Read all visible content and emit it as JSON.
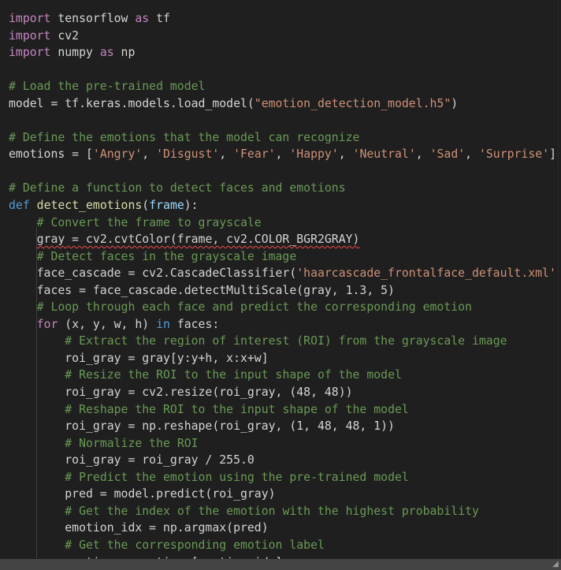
{
  "editor": {
    "language": "python",
    "lines": [
      [
        [
          "kw2",
          "import"
        ],
        [
          "p",
          " tensorflow "
        ],
        [
          "kw2",
          "as"
        ],
        [
          "p",
          " tf"
        ]
      ],
      [
        [
          "kw2",
          "import"
        ],
        [
          "p",
          " cv2"
        ]
      ],
      [
        [
          "kw2",
          "import"
        ],
        [
          "p",
          " numpy "
        ],
        [
          "kw2",
          "as"
        ],
        [
          "p",
          " np"
        ]
      ],
      [],
      [
        [
          "cm",
          "# Load the pre-trained model"
        ]
      ],
      [
        [
          "p",
          "model = tf.keras.models.load_model("
        ],
        [
          "st",
          "\"emotion_detection_model.h5\""
        ],
        [
          "p",
          ")"
        ]
      ],
      [],
      [
        [
          "cm",
          "# Define the emotions that the model can recognize"
        ]
      ],
      [
        [
          "p",
          "emotions = ["
        ],
        [
          "st",
          "'Angry'"
        ],
        [
          "p",
          ", "
        ],
        [
          "st",
          "'Disgust'"
        ],
        [
          "p",
          ", "
        ],
        [
          "st",
          "'Fear'"
        ],
        [
          "p",
          ", "
        ],
        [
          "st",
          "'Happy'"
        ],
        [
          "p",
          ", "
        ],
        [
          "st",
          "'Neutral'"
        ],
        [
          "p",
          ", "
        ],
        [
          "st",
          "'Sad'"
        ],
        [
          "p",
          ", "
        ],
        [
          "st",
          "'Surprise'"
        ],
        [
          "p",
          "]"
        ]
      ],
      [],
      [
        [
          "cm",
          "# Define a function to detect faces and emotions"
        ]
      ],
      [
        [
          "kw",
          "def"
        ],
        [
          "p",
          " "
        ],
        [
          "fn",
          "detect_emotions"
        ],
        [
          "p",
          "("
        ],
        [
          "vr",
          "frame"
        ],
        [
          "p",
          "):"
        ]
      ],
      [
        [
          "p",
          "    "
        ],
        [
          "cm",
          "# Convert the frame to grayscale"
        ]
      ],
      [
        [
          "p",
          "    "
        ],
        [
          "sq",
          "gray = cv2.cvtColor(frame, cv2.COLOR_BGR2GRAY)"
        ]
      ],
      [
        [
          "p",
          "    "
        ],
        [
          "cm",
          "# Detect faces in the grayscale image"
        ]
      ],
      [
        [
          "p",
          "    face_cascade = cv2.CascadeClassifier("
        ],
        [
          "st",
          "'haarcascade_frontalface_default.xml'"
        ],
        [
          "p",
          ")"
        ]
      ],
      [
        [
          "p",
          "    faces = face_cascade.detectMultiScale(gray, 1.3, 5)"
        ]
      ],
      [
        [
          "p",
          "    "
        ],
        [
          "cm",
          "# Loop through each face and predict the corresponding emotion"
        ]
      ],
      [
        [
          "p",
          "    "
        ],
        [
          "kw2",
          "for"
        ],
        [
          "p",
          " (x, y, w, h) "
        ],
        [
          "kw",
          "in"
        ],
        [
          "p",
          " faces:"
        ]
      ],
      [
        [
          "p",
          "        "
        ],
        [
          "cm",
          "# Extract the region of interest (ROI) from the grayscale image"
        ]
      ],
      [
        [
          "p",
          "        roi_gray = gray[y:y+h, x:x+w]"
        ]
      ],
      [
        [
          "p",
          "        "
        ],
        [
          "cm",
          "# Resize the ROI to the input shape of the model"
        ]
      ],
      [
        [
          "p",
          "        roi_gray = cv2.resize(roi_gray, (48, 48))"
        ]
      ],
      [
        [
          "p",
          "        "
        ],
        [
          "cm",
          "# Reshape the ROI to the input shape of the model"
        ]
      ],
      [
        [
          "p",
          "        roi_gray = np.reshape(roi_gray, (1, 48, 48, 1))"
        ]
      ],
      [
        [
          "p",
          "        "
        ],
        [
          "cm",
          "# Normalize the ROI"
        ]
      ],
      [
        [
          "p",
          "        roi_gray = roi_gray / 255.0"
        ]
      ],
      [
        [
          "p",
          "        "
        ],
        [
          "cm",
          "# Predict the emotion using the pre-trained model"
        ]
      ],
      [
        [
          "p",
          "        pred = model.predict(roi_gray)"
        ]
      ],
      [
        [
          "p",
          "        "
        ],
        [
          "cm",
          "# Get the index of the emotion with the highest probability"
        ]
      ],
      [
        [
          "p",
          "        emotion_idx = np.argmax(pred)"
        ]
      ],
      [
        [
          "p",
          "        "
        ],
        [
          "cm",
          "# Get the corresponding emotion label"
        ]
      ],
      [
        [
          "p",
          "        emotion = emotions[emotion_idx]"
        ]
      ]
    ]
  },
  "statusbar": {
    "resize_icon": "resize-grip-icon"
  },
  "colors": {
    "background": "#1f1f1f",
    "text": "#d4d4d4",
    "keyword": "#569cd6",
    "control_keyword": "#c586c0",
    "comment": "#6a9955",
    "string": "#ce9178",
    "function": "#dcdcaa",
    "parameter": "#9cdcfe",
    "error_squiggle": "#f14c4c"
  }
}
